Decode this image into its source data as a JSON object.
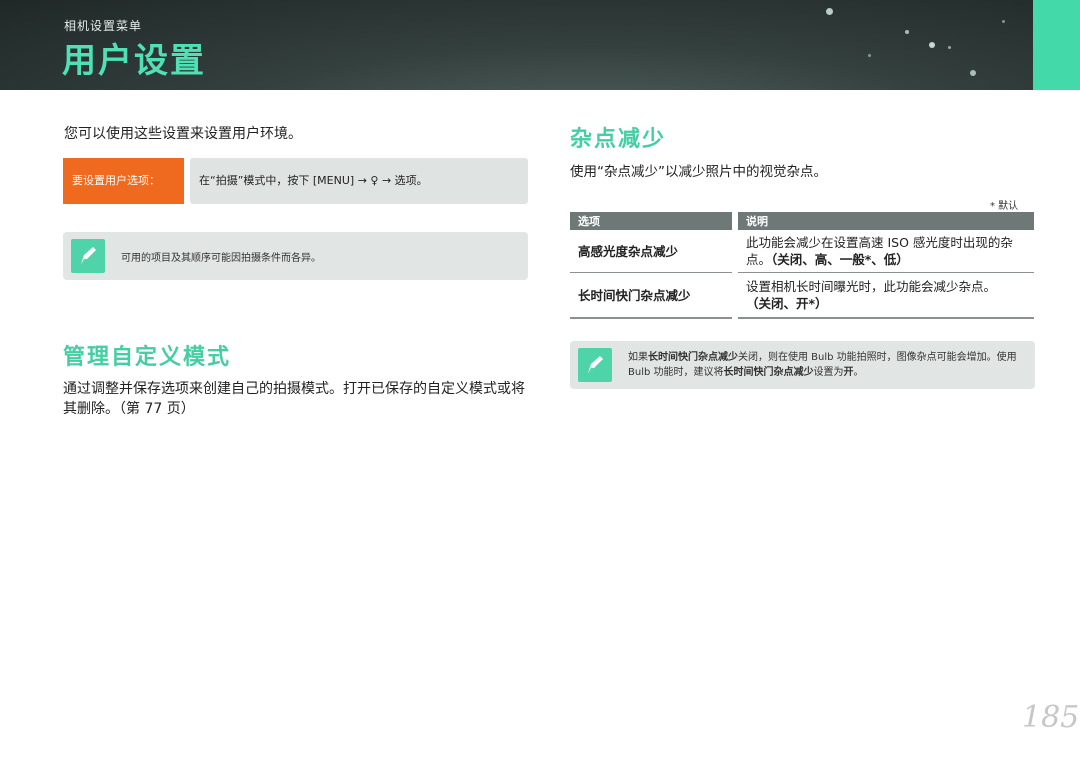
{
  "header": {
    "subtitle": "相机设置菜单",
    "title": "用户设置",
    "corner_tab_color": "#44d9a8"
  },
  "left": {
    "intro": "您可以使用这些设置来设置用户环境。",
    "howto": {
      "label": "要设置用户选项：",
      "step": "在“拍摄”模式中，按下 [MENU] → ♀ → 选项。"
    },
    "note": {
      "icon": "pencil-note-icon",
      "text": "可用的项目及其顺序可能因拍摄条件而各异。"
    },
    "custom_mode": {
      "heading": "管理自定义模式",
      "desc": "通过调整并保存选项来创建自己的拍摄模式。打开已保存的自定义模式或将其删除。（第 77 页）"
    }
  },
  "right": {
    "heading": "杂点减少",
    "desc": "使用“杂点减少”以减少照片中的视觉杂点。",
    "default_note": "* 默认",
    "table": {
      "headers": [
        "选项",
        "说明"
      ],
      "rows": [
        {
          "option": "高感光度杂点减少",
          "desc": "此功能会减少在设置高速 ISO 感光度时出现的杂点。",
          "values": "（关闭、高、一般*、低）"
        },
        {
          "option": "长时间快门杂点减少",
          "desc": "设置相机长时间曝光时，此功能会减少杂点。",
          "values": "（关闭、开*）"
        }
      ]
    },
    "note": {
      "icon": "pencil-note-icon",
      "t1": "如果",
      "b1": "长时间快门杂点减少",
      "t2": "关闭，则在使用 Bulb 功能拍照时，图像杂点可能会增加。使用 Bulb 功能时，建议将",
      "b2": "长时间快门杂点减少",
      "t3": "设置为",
      "b3": "开",
      "t4": "。"
    }
  },
  "page_number": "185",
  "colors": {
    "accent_green": "#43cfa2",
    "orange": "#ef6a1f",
    "header_dark": "#2b3634"
  }
}
